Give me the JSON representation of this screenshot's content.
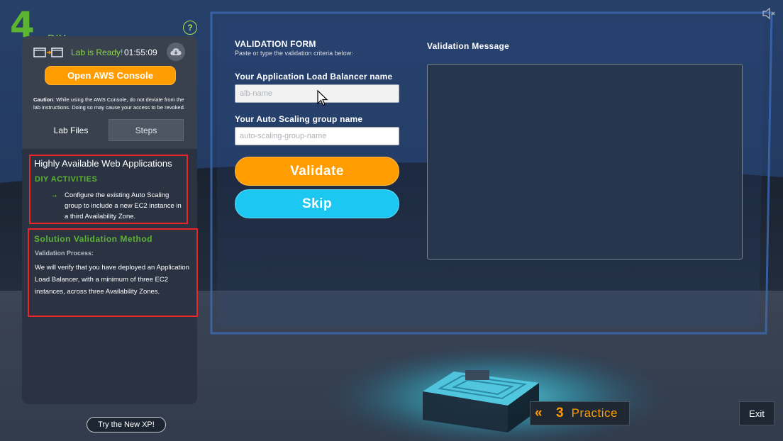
{
  "brand": {
    "number": "4",
    "label": "DIY"
  },
  "colors": {
    "accent_orange": "#ff9d00",
    "accent_green": "#5cb531",
    "accent_cyan": "#1cc7f2",
    "highlight_red": "#e8262a"
  },
  "lab": {
    "status_text": "Lab is Ready!",
    "timer": "01:55:09",
    "open_console_label": "Open AWS Console",
    "caution_label": "Caution",
    "caution_text": ": While using the AWS Console, do not deviate from the lab instructions. Doing so may cause your access to be revoked."
  },
  "tabs": [
    {
      "label": "Lab Files"
    },
    {
      "label": "Steps"
    }
  ],
  "diy": {
    "heading": "Highly Available Web Applications",
    "subheading": "DIY ACTIVITIES",
    "task": "Configure the existing Auto Scaling group to include a new EC2 instance in a third Availability Zone."
  },
  "validation_method": {
    "heading": "Solution Validation Method",
    "process_label": "Validation Process:",
    "body": "We will verify that you have deployed an Application Load Balancer, with a minimum of three EC2 instances, across three Availability Zones."
  },
  "try_new_label": "Try the New XP!",
  "form": {
    "title": "VALIDATION FORM",
    "subtitle": "Paste or type the validation criteria below:",
    "alb_label": "Your Application Load Balancer name",
    "alb_placeholder": "alb-name",
    "asg_label": "Your Auto Scaling group name",
    "asg_placeholder": "auto-scaling-group-name",
    "validate_label": "Validate",
    "skip_label": "Skip",
    "message_title": "Validation Message"
  },
  "footer": {
    "practice_number": "3",
    "practice_label": "Practice",
    "exit_label": "Exit"
  },
  "icons": [
    "help-icon",
    "console-window-icon",
    "cloud-download-icon",
    "arrow-right-icon",
    "double-chevron-left-icon",
    "mute-icon",
    "mouse-cursor-icon"
  ]
}
